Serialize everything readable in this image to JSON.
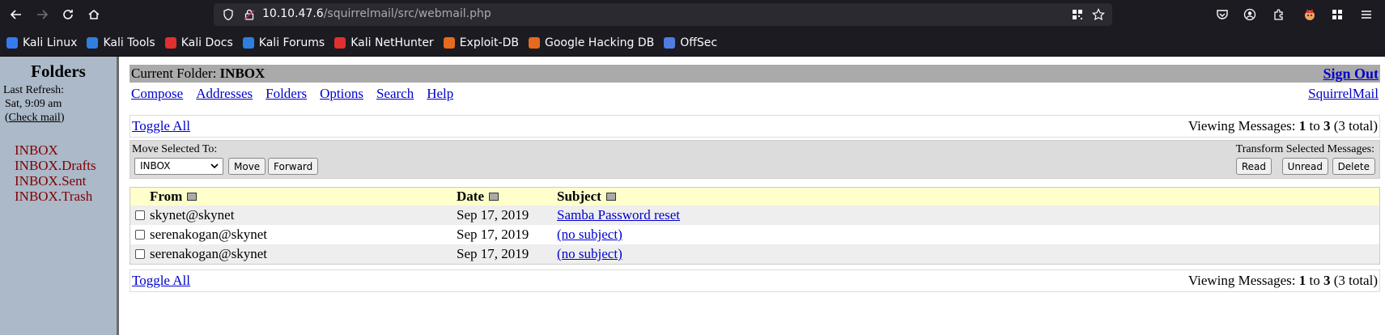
{
  "browser": {
    "url_host": "10.10.47.6",
    "url_path": "/squirrelmail/src/webmail.php",
    "bookmarks": [
      {
        "label": "Kali Linux",
        "icon": "kali-dragon-icon",
        "color": "#367bf0"
      },
      {
        "label": "Kali Tools",
        "icon": "kali-tools-icon",
        "color": "#2f7fe0"
      },
      {
        "label": "Kali Docs",
        "icon": "kali-docs-icon",
        "color": "#e0302f"
      },
      {
        "label": "Kali Forums",
        "icon": "kali-forums-icon",
        "color": "#2f7fe0"
      },
      {
        "label": "Kali NetHunter",
        "icon": "kali-nethunter-icon",
        "color": "#e0302f"
      },
      {
        "label": "Exploit-DB",
        "icon": "exploit-db-icon",
        "color": "#e66b1f"
      },
      {
        "label": "Google Hacking DB",
        "icon": "ghdb-icon",
        "color": "#e66b1f"
      },
      {
        "label": "OffSec",
        "icon": "offsec-icon",
        "color": "#4f7de0"
      }
    ]
  },
  "sidebar": {
    "title": "Folders",
    "last_refresh_label": "Last Refresh:",
    "last_refresh_time": "Sat, 9:09 am",
    "check_mail_open": "(",
    "check_mail": "Check mail",
    "check_mail_close": ")",
    "folders": [
      "INBOX",
      "INBOX.Drafts",
      "INBOX.Sent",
      "INBOX.Trash"
    ]
  },
  "header": {
    "current_folder_label": "Current Folder: ",
    "current_folder": "INBOX",
    "sign_out": "Sign Out",
    "menu": [
      "Compose",
      "Addresses",
      "Folders",
      "Options",
      "Search",
      "Help"
    ],
    "brand_link": "SquirrelMail"
  },
  "list": {
    "toggle_all": "Toggle All",
    "viewing_prefix": "Viewing Messages: ",
    "viewing_from": "1",
    "viewing_to_word": " to ",
    "viewing_to": "3",
    "viewing_total": " (3 total)",
    "move_selected_label": "Move Selected To:",
    "transform_label": "Transform Selected Messages:",
    "move_target": "INBOX",
    "move_button": "Move",
    "forward_button": "Forward",
    "read_button": "Read",
    "unread_button": "Unread",
    "delete_button": "Delete",
    "columns": {
      "from": "From",
      "date": "Date",
      "subject": "Subject"
    },
    "messages": [
      {
        "from": "skynet@skynet",
        "date": "Sep 17, 2019",
        "subject": "Samba Password reset"
      },
      {
        "from": "serenakogan@skynet",
        "date": "Sep 17, 2019",
        "subject": "(no subject)"
      },
      {
        "from": "serenakogan@skynet",
        "date": "Sep 17, 2019",
        "subject": "(no subject)"
      }
    ]
  }
}
